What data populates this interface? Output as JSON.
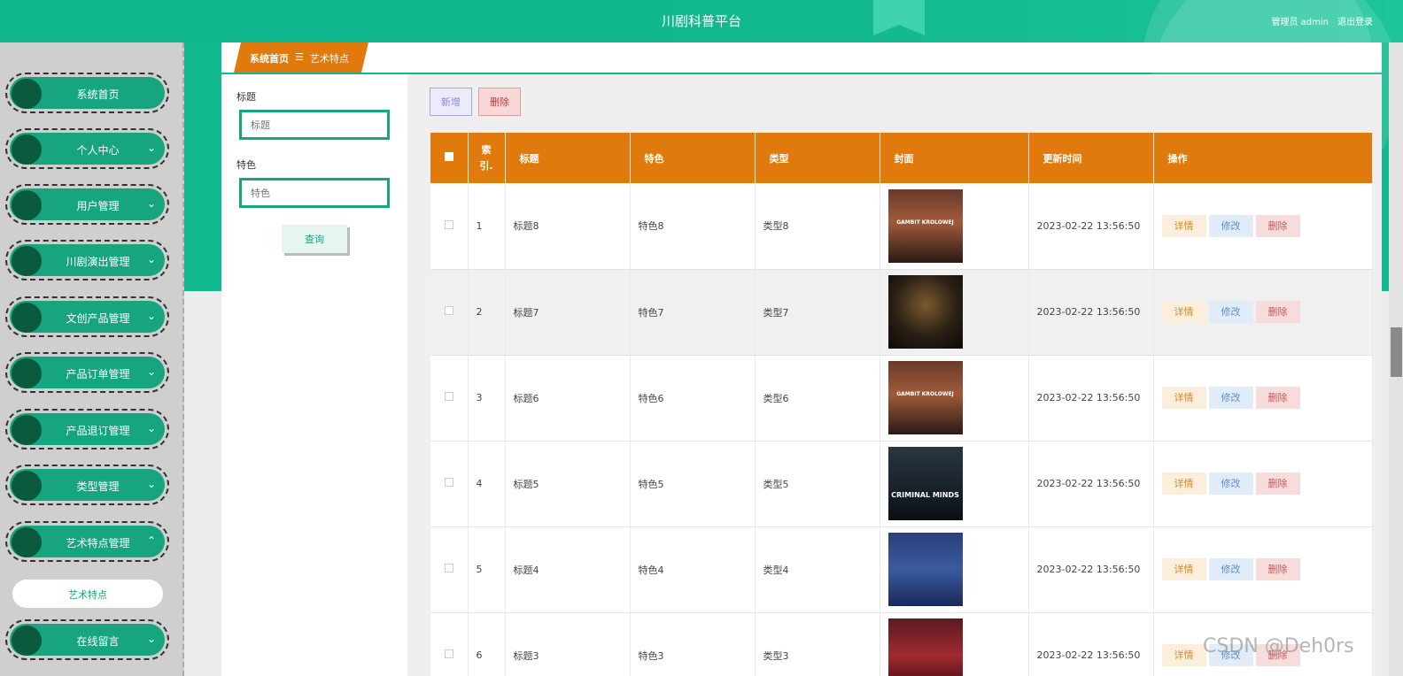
{
  "header": {
    "title": "川剧科普平台",
    "user": "管理员 admin",
    "logout": "退出登录"
  },
  "sidebar": {
    "items": [
      {
        "label": "系统首页",
        "chevron": ""
      },
      {
        "label": "个人中心",
        "chevron": "⌄"
      },
      {
        "label": "用户管理",
        "chevron": "⌄"
      },
      {
        "label": "川剧演出管理",
        "chevron": "⌄"
      },
      {
        "label": "文创产品管理",
        "chevron": "⌄"
      },
      {
        "label": "产品订单管理",
        "chevron": "⌄"
      },
      {
        "label": "产品退订管理",
        "chevron": "⌄"
      },
      {
        "label": "类型管理",
        "chevron": "⌄"
      },
      {
        "label": "艺术特点管理",
        "chevron": "⌃"
      },
      {
        "label": "在线留言",
        "chevron": "⌄"
      }
    ],
    "submenu": "艺术特点"
  },
  "breadcrumb": {
    "home": "系统首页",
    "sep": "☰",
    "current": "艺术特点"
  },
  "search": {
    "title_label": "标题",
    "title_placeholder": "标题",
    "feature_label": "特色",
    "feature_placeholder": "特色",
    "query_button": "查询"
  },
  "toolbar": {
    "add": "新增",
    "delete": "删除"
  },
  "table": {
    "headers": {
      "index": "索\n引.",
      "title": "标题",
      "feature": "特色",
      "type": "类型",
      "cover": "封面",
      "updated": "更新时间",
      "actions": "操作"
    },
    "rows": [
      {
        "idx": "1",
        "title": "标题8",
        "feature": "特色8",
        "type": "类型8",
        "cover_text": "GAMBIT KROLOWEJ",
        "updated": "2023-02-22 13:56:50"
      },
      {
        "idx": "2",
        "title": "标题7",
        "feature": "特色7",
        "type": "类型7",
        "cover_text": "",
        "updated": "2023-02-22 13:56:50"
      },
      {
        "idx": "3",
        "title": "标题6",
        "feature": "特色6",
        "type": "类型6",
        "cover_text": "GAMBIT KROLOWEJ",
        "updated": "2023-02-22 13:56:50"
      },
      {
        "idx": "4",
        "title": "标题5",
        "feature": "特色5",
        "type": "类型5",
        "cover_text": "CRIMINAL MINDS",
        "updated": "2023-02-22 13:56:50"
      },
      {
        "idx": "5",
        "title": "标题4",
        "feature": "特色4",
        "type": "类型4",
        "cover_text": "",
        "updated": "2023-02-22 13:56:50"
      },
      {
        "idx": "6",
        "title": "标题3",
        "feature": "特色3",
        "type": "类型3",
        "cover_text": "",
        "updated": "2023-02-22 13:56:50"
      }
    ],
    "row_actions": {
      "detail": "详情",
      "edit": "修改",
      "delete": "删除"
    }
  },
  "watermark": "CSDN @Deh0rs",
  "colors": {
    "primary": "#16a57f",
    "header_orange": "#e07a0c"
  }
}
